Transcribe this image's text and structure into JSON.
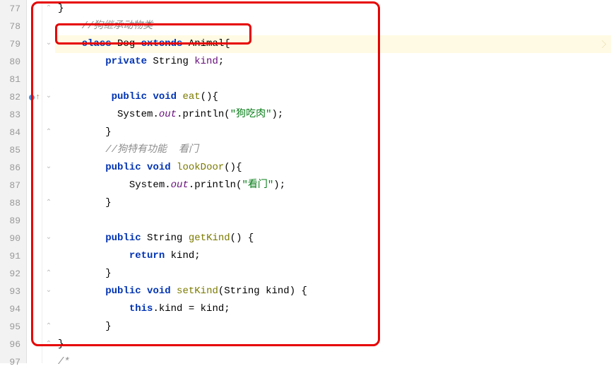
{
  "lines": [
    {
      "num": "77"
    },
    {
      "num": "78"
    },
    {
      "num": "79"
    },
    {
      "num": "80"
    },
    {
      "num": "81"
    },
    {
      "num": "82"
    },
    {
      "num": "83"
    },
    {
      "num": "84"
    },
    {
      "num": "85"
    },
    {
      "num": "86"
    },
    {
      "num": "87"
    },
    {
      "num": "88"
    },
    {
      "num": "89"
    },
    {
      "num": "90"
    },
    {
      "num": "91"
    },
    {
      "num": "92"
    },
    {
      "num": "93"
    },
    {
      "num": "94"
    },
    {
      "num": "95"
    },
    {
      "num": "96"
    },
    {
      "num": "97"
    }
  ],
  "code": {
    "l77": "}",
    "l78_comment": "//狗继承动物类",
    "l79": {
      "kw_class": "class",
      "name": " Dog ",
      "kw_extends": "extends",
      "parent": " Animal{"
    },
    "l80": {
      "kw_private": "private",
      "type": " String ",
      "field": "kind",
      "end": ";"
    },
    "l81": "",
    "l82": {
      "kw_public": "public",
      "kw_void": "void",
      "method": " eat",
      "params": "(){"
    },
    "l83": {
      "sys": "System.",
      "out": "out",
      "call": ".println(",
      "str": "\"狗吃肉\"",
      "end": ");"
    },
    "l84": "}",
    "l85_comment": "//狗特有功能  看门",
    "l86": {
      "kw_public": "public",
      "kw_void": "void",
      "method": " lookDoor",
      "params": "(){"
    },
    "l87": {
      "sys": "System.",
      "out": "out",
      "call": ".println(",
      "str": "\"看门\"",
      "end": ");"
    },
    "l88": "}",
    "l89": "",
    "l90": {
      "kw_public": "public",
      "type": " String ",
      "method": "getKind",
      "params": "() {"
    },
    "l91": {
      "kw_return": "return",
      "field": " kind",
      "end": ";"
    },
    "l92": "}",
    "l93": {
      "kw_public": "public",
      "kw_void": "void",
      "method": " setKind",
      "params": "(String kind) {"
    },
    "l94": {
      "kw_this": "this",
      "dot": ".",
      "field": "kind",
      "rest": " = kind;"
    },
    "l95": "}",
    "l96": "}",
    "l97_comment": "/*"
  },
  "indent": {
    "i1": "    ",
    "i2": "        ",
    "i3": "            "
  }
}
